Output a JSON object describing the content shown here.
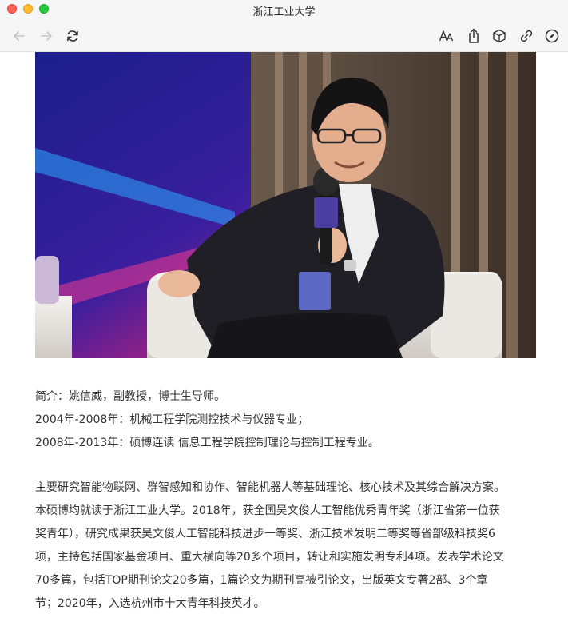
{
  "window": {
    "title": "浙江工业大学"
  },
  "icons": {
    "back": "arrow-left-icon",
    "forward": "arrow-right-icon",
    "reload": "reload-icon",
    "text_size": "text-size-icon",
    "share": "share-icon",
    "package": "cube-icon",
    "link": "link-icon",
    "compass": "compass-icon"
  },
  "intro": {
    "line1": "简介：姚信威，副教授，博士生导师。",
    "line2": "2004年-2008年：机械工程学院测控技术与仪器专业；",
    "line3": "2008年-2013年：硕博连读 信息工程学院控制理论与控制工程专业。"
  },
  "bio": {
    "lines": [
      "主要研究智能物联网、群智感知和协作、智能机器人等基础理论、核心技术及其综合解决方案。",
      "本硕博均就读于浙江工业大学。2018年，获全国吴文俊人工智能优秀青年奖（浙江省第一位获",
      "奖青年），研究成果获吴文俊人工智能科技进步一等奖、浙江技术发明二等奖等省部级科技奖6",
      "项，主持包括国家基金项目、重大横向等20多个项目，转让和实施发明专利4项。发表学术论文",
      "70多篇，包括TOP期刊论文20多篇，1篇论文为期刊高被引论文，出版英文专著2部、3个章",
      "节；2020年，入选杭州市十大青年科技英才。"
    ]
  },
  "colors": {
    "titlebar": "#f6f6f6",
    "text": "#333333"
  }
}
